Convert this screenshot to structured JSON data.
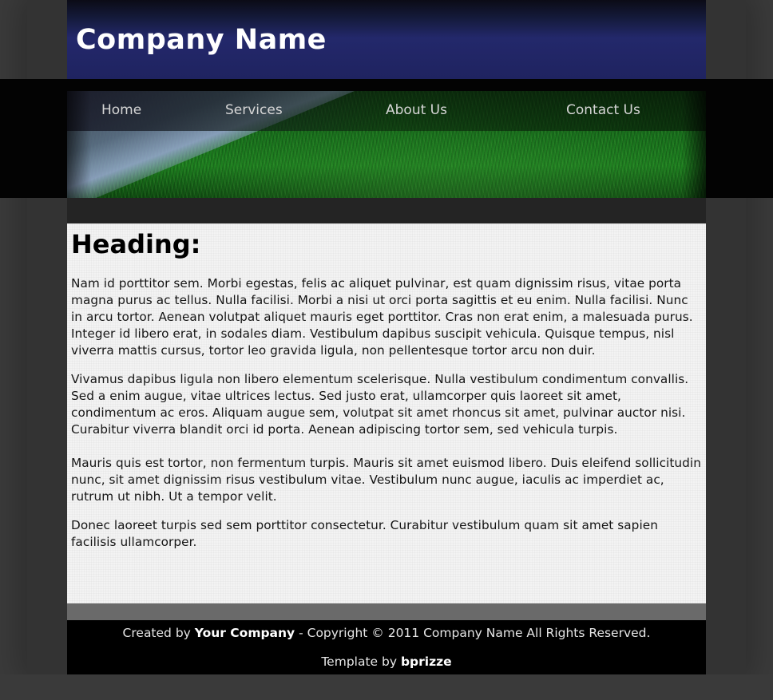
{
  "header": {
    "company_name": "Company Name"
  },
  "nav": {
    "items": [
      {
        "label": "Home"
      },
      {
        "label": "Services"
      },
      {
        "label": "About Us"
      },
      {
        "label": "Contact Us"
      }
    ]
  },
  "main": {
    "heading": "Heading:",
    "paragraphs": [
      "Nam id porttitor sem. Morbi egestas, felis ac aliquet pulvinar, est quam dignissim risus, vitae porta magna purus ac tellus. Nulla facilisi. Morbi a nisi ut orci porta sagittis et eu enim. Nulla facilisi. Nunc in arcu tortor. Aenean volutpat aliquet mauris eget porttitor. Cras non erat enim, a malesuada purus. Integer id libero erat, in sodales diam. Vestibulum dapibus suscipit vehicula. Quisque tempus, nisl viverra mattis cursus, tortor leo gravida ligula, non pellentesque tortor arcu non duir.",
      "Vivamus dapibus ligula non libero elementum scelerisque. Nulla vestibulum condimentum convallis. Sed a enim augue, vitae ultrices lectus. Sed justo erat, ullamcorper quis laoreet sit amet, condimentum ac eros. Aliquam augue sem, volutpat sit amet rhoncus sit amet, pulvinar auctor nisi. Curabitur viverra blandit orci id porta. Aenean adipiscing tortor sem, sed vehicula turpis.",
      "Mauris quis est tortor, non fermentum turpis. Mauris sit amet euismod libero. Duis eleifend sollicitudin nunc, sit amet dignissim risus vestibulum vitae. Vestibulum nunc augue, iaculis ac imperdiet ac, rutrum ut nibh. Ut a tempor velit.",
      "Donec laoreet turpis sed sem porttitor consectetur. Curabitur vestibulum quam sit amet sapien facilisis ullamcorper."
    ]
  },
  "footer": {
    "created_by_prefix": "Created by ",
    "created_by_company": "Your Company",
    "copyright": " - Copyright © 2011 Company Name All Rights Reserved.",
    "template_by_prefix": "Template by ",
    "template_author": "bprizze"
  },
  "colors": {
    "header_blue": "#23286b",
    "banner_green": "#1d7f1f",
    "content_bg": "#f3f3f3",
    "footer_bg": "#000000"
  }
}
